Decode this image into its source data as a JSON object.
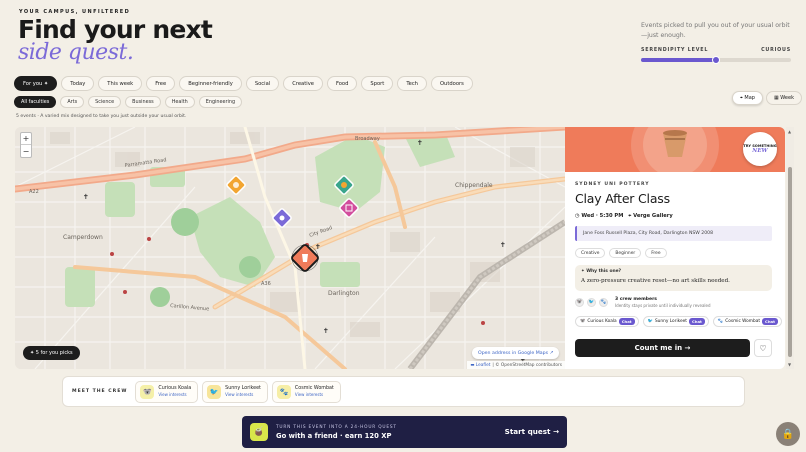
{
  "header": {
    "eyebrow": "YOUR CAMPUS, UNFILTERED",
    "title_line1": "Find your next",
    "title_line2": "side quest.",
    "tagline": "Events picked to pull you out of your usual orbit—just enough.",
    "slider": {
      "left_label": "SERENDIPITY LEVEL",
      "right_label": "CURIOUS",
      "value": 0.5
    }
  },
  "filters": {
    "categories": [
      "For you ✦",
      "Today",
      "This week",
      "Free",
      "Beginner-friendly",
      "Social",
      "Creative",
      "Food",
      "Sport",
      "Tech",
      "Outdoors"
    ],
    "faculties": [
      "All faculties",
      "Arts",
      "Science",
      "Business",
      "Health",
      "Engineering"
    ]
  },
  "view_toggle": {
    "map": "⌖ Map",
    "week": "▦ Week"
  },
  "summary": "5 events · A varied mix designed to take you just outside your usual orbit.",
  "map": {
    "zoom_in": "+",
    "zoom_out": "−",
    "picks_label": "✦ 5 for you picks",
    "gmaps_label": "Open address in Google Maps ↗",
    "attribution_link": "▬ Leaflet",
    "attribution": "| © OpenStreetMap contributors",
    "street_labels": [
      "Parramatta Road",
      "Broadway",
      "Chippendale",
      "Camperdown",
      "Darlington",
      "City Road",
      "Carillon Avenue",
      "A22",
      "A36"
    ]
  },
  "event": {
    "badge_top": "TRY SOMETHING",
    "badge_new": "NEW",
    "organizer": "SYDNEY UNI POTTERY",
    "title": "Clay After Class",
    "time": "◷ Wed · 5:30 PM",
    "venue": "⌖ Verge Gallery",
    "address": "Jane Foss Russell Plaza, City Road, Darlington NSW 2008",
    "tags": [
      "Creative",
      "Beginner",
      "Free"
    ],
    "why_label": "✦ Why this one?",
    "why_text": "A zero-pressure creative reset—no art skills needed.",
    "crew_count": "3 crew members",
    "crew_sub": "Identity stays private until individually revealed",
    "members": [
      {
        "name": "Curious Koala",
        "icon": "🐨",
        "chat": "Chat"
      },
      {
        "name": "Sunny Lorikeet",
        "icon": "🐦",
        "chat": "Chat"
      },
      {
        "name": "Cosmic Wombat",
        "icon": "🐾",
        "chat": "Chat"
      }
    ],
    "cta": "Count me in →",
    "heart": "♡"
  },
  "crew_bar": {
    "label": "MEET THE CREW",
    "members": [
      {
        "name": "Curious Koala",
        "link": "View interests",
        "icon": "🐨",
        "color": "#f5f0a8"
      },
      {
        "name": "Sunny Lorikeet",
        "link": "View interests",
        "icon": "🐦",
        "color": "#f7e59a"
      },
      {
        "name": "Cosmic Wombat",
        "link": "View interests",
        "icon": "🐾",
        "color": "#f6eea6"
      }
    ]
  },
  "quest": {
    "small": "TURN THIS EVENT INTO A 24-HOUR QUEST",
    "large": "Go with a friend · earn 120 XP",
    "cta": "Start quest →",
    "icon": "🧉"
  },
  "lock_icon": "🔒",
  "colors": {
    "accent": "#6a58cf",
    "coral": "#ef7b5a",
    "dark": "#1d1d1d",
    "cream": "#f3efe6"
  }
}
